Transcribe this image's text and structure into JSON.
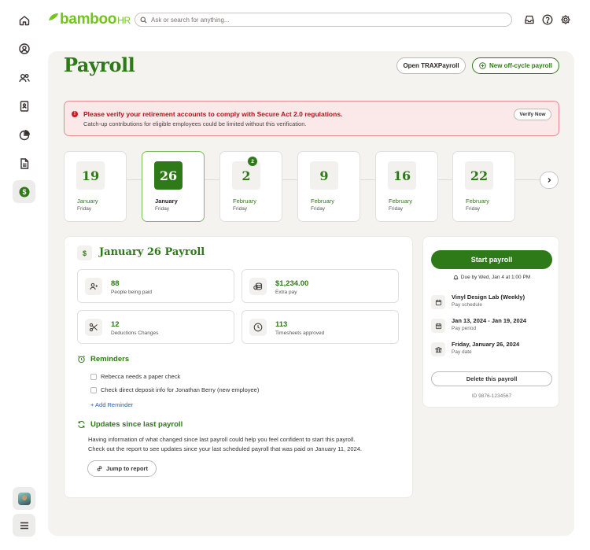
{
  "app": {
    "logo_text": "bamboo",
    "logo_suffix": "HR",
    "brand_color": "#73c41d",
    "accent_color": "#2e7918"
  },
  "search": {
    "placeholder": "Ask or search for anything..."
  },
  "rail": {
    "items": [
      "home-icon",
      "profile-icon",
      "people-icon",
      "directory-icon",
      "reports-icon",
      "documents-icon",
      "payroll-icon"
    ],
    "active": "payroll-icon"
  },
  "topbar": {
    "icons": [
      "inbox-icon",
      "help-icon",
      "settings-icon"
    ]
  },
  "page": {
    "title": "Payroll"
  },
  "header_buttons": {
    "open_trax": "Open TRAXPayroll",
    "new_offcycle": "New off-cycle payroll"
  },
  "alert": {
    "title": "Please verify your retirement accounts to comply with Secure Act 2.0 regulations.",
    "subtitle": "Catch-up contributions for eligible employees could be limited without this verification.",
    "button": "Verify Now",
    "color": "#c81e28"
  },
  "dates": [
    {
      "day": "19",
      "month": "January",
      "weekday": "Friday",
      "selected": false,
      "badge": ""
    },
    {
      "day": "26",
      "month": "January",
      "weekday": "Friday",
      "selected": true,
      "badge": ""
    },
    {
      "day": "2",
      "month": "February",
      "weekday": "Friday",
      "selected": false,
      "badge": "2"
    },
    {
      "day": "9",
      "month": "February",
      "weekday": "Friday",
      "selected": false,
      "badge": ""
    },
    {
      "day": "16",
      "month": "February",
      "weekday": "Friday",
      "selected": false,
      "badge": ""
    },
    {
      "day": "22",
      "month": "February",
      "weekday": "Friday",
      "selected": false,
      "badge": ""
    }
  ],
  "detail": {
    "icon": "$",
    "title": "January 26 Payroll",
    "stats": [
      {
        "value": "88",
        "label": "People being paid",
        "icon": "people-icon"
      },
      {
        "value": "$1,234.00",
        "label": "Extra pay",
        "icon": "coins-icon"
      },
      {
        "value": "12",
        "label": "Deductions Changes",
        "icon": "scissors-icon"
      },
      {
        "value": "113",
        "label": "Timesheets approved",
        "icon": "clock-icon"
      }
    ],
    "reminders": {
      "heading": "Reminders",
      "items": [
        "Rebecca needs a paper check",
        "Check direct deposit info for Jonathan Berry (new employee)"
      ],
      "add_label": "+ Add Reminder"
    },
    "updates": {
      "heading": "Updates since last payroll",
      "line1": "Having information of what changed since last payroll could help you feel confident to start this payroll.",
      "line2": "Check out the report to see updates since your last scheduled payroll that was paid on January 11, 2024.",
      "button": "Jump to report"
    }
  },
  "side": {
    "start_button": "Start payroll",
    "due": "Due by Wed, Jan 4 at 1:00 PM",
    "rows": [
      {
        "main": "Vinyl Design Lab (Weekly)",
        "sub": "Pay schedule",
        "icon": "calendar-icon"
      },
      {
        "main": "Jan 13, 2024 - Jan 19, 2024",
        "sub": "Pay period",
        "icon": "calendar-range-icon"
      },
      {
        "main": "Friday, January 26, 2024",
        "sub": "Pay date",
        "icon": "bank-icon"
      }
    ],
    "delete_button": "Delete this payroll",
    "id": "ID 9876-1234567"
  }
}
